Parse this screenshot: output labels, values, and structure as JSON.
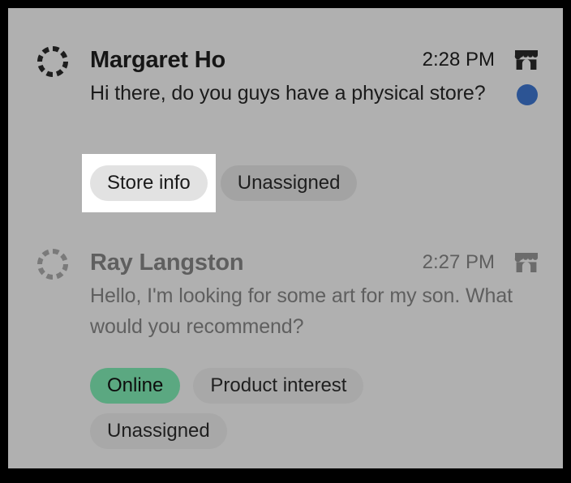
{
  "app": {
    "view": "conversation-list",
    "surface_color": "#b0b0b0",
    "frame_color": "#000000"
  },
  "focus": {
    "target": "Store info",
    "highlight_color": "#ffffff"
  },
  "colors": {
    "unread_dot": "#2c5494",
    "tag_default": "#a0a0a0",
    "tag_selected": "#e2e2e2",
    "tag_online": "#5ba881",
    "text_unread": "#161616",
    "text_read": "#5f5f5f"
  },
  "conversations": [
    {
      "id": "margaret-ho",
      "state": "unread",
      "avatar_icon": "dashed-circle-avatar",
      "name": "Margaret Ho",
      "timestamp": "2:28 PM",
      "channel_icon": "storefront-icon",
      "preview": "Hi there, do you guys have a physical store?",
      "unread_indicator": true,
      "tag_rows": [
        [
          {
            "label": "Store info",
            "style": "light",
            "focused": true
          },
          {
            "label": "Unassigned",
            "style": "muted",
            "focused": false
          }
        ]
      ]
    },
    {
      "id": "ray-langston",
      "state": "read",
      "avatar_icon": "dashed-circle-avatar",
      "name": "Ray Langston",
      "timestamp": "2:27 PM",
      "channel_icon": "storefront-icon",
      "preview": "Hello, I'm looking for some art for my son. What would you recommend?",
      "unread_indicator": false,
      "tag_rows": [
        [
          {
            "label": "Online",
            "style": "green",
            "focused": false
          },
          {
            "label": "Product interest",
            "style": "dim",
            "focused": false
          }
        ],
        [
          {
            "label": "Unassigned",
            "style": "dim",
            "focused": false
          }
        ]
      ]
    }
  ]
}
